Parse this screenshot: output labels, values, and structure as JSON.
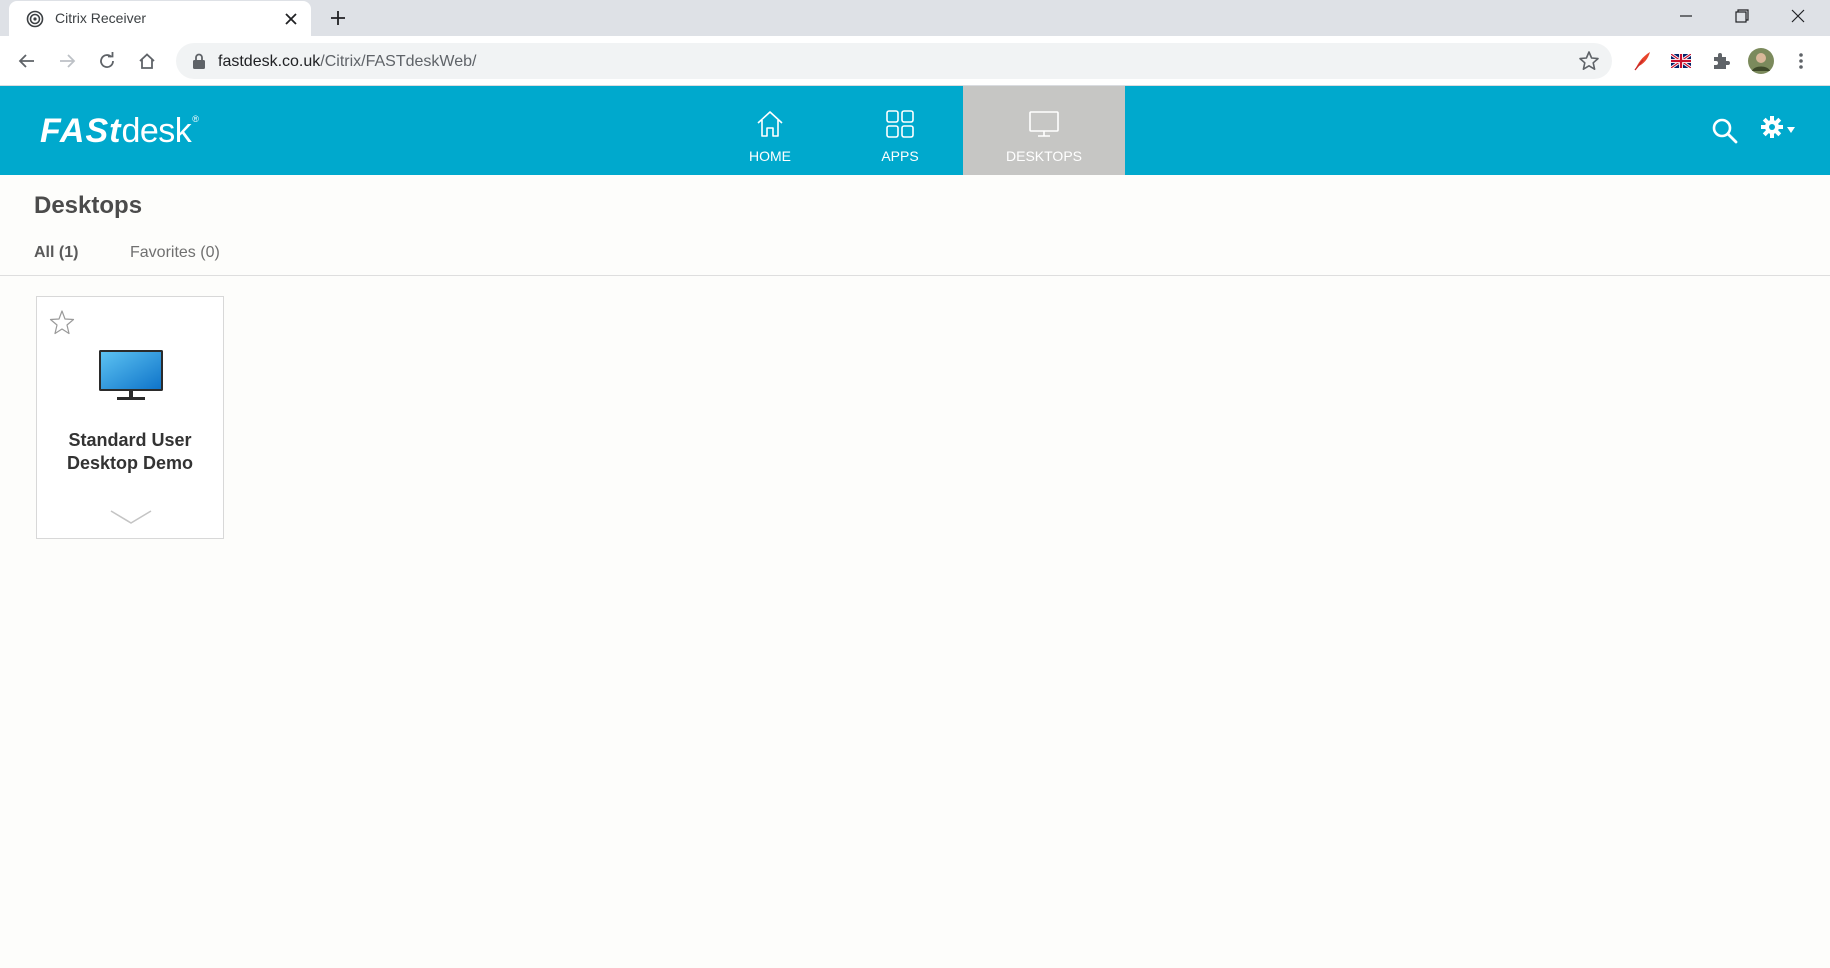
{
  "browser": {
    "tab_title": "Citrix Receiver",
    "url_host": "fastdesk.co.uk",
    "url_path": "/Citrix/FASTdeskWeb/"
  },
  "app": {
    "logo_bold": "FASt",
    "logo_rest": "desk",
    "logo_mark": "®",
    "accent_color": "#00a9cd",
    "active_tab_color": "#c6c6c4",
    "nav": [
      {
        "label": "HOME",
        "icon": "home-icon"
      },
      {
        "label": "APPS",
        "icon": "apps-grid-icon"
      },
      {
        "label": "DESKTOPS",
        "icon": "monitor-icon",
        "active": true
      }
    ]
  },
  "page": {
    "title": "Desktops",
    "filters": [
      {
        "label": "All (1)",
        "active": true
      },
      {
        "label": "Favorites (0)",
        "active": false
      }
    ],
    "desktops": [
      {
        "name": "Standard User Desktop Demo",
        "icon": "desktop-monitor-icon",
        "favorite": false
      }
    ]
  }
}
